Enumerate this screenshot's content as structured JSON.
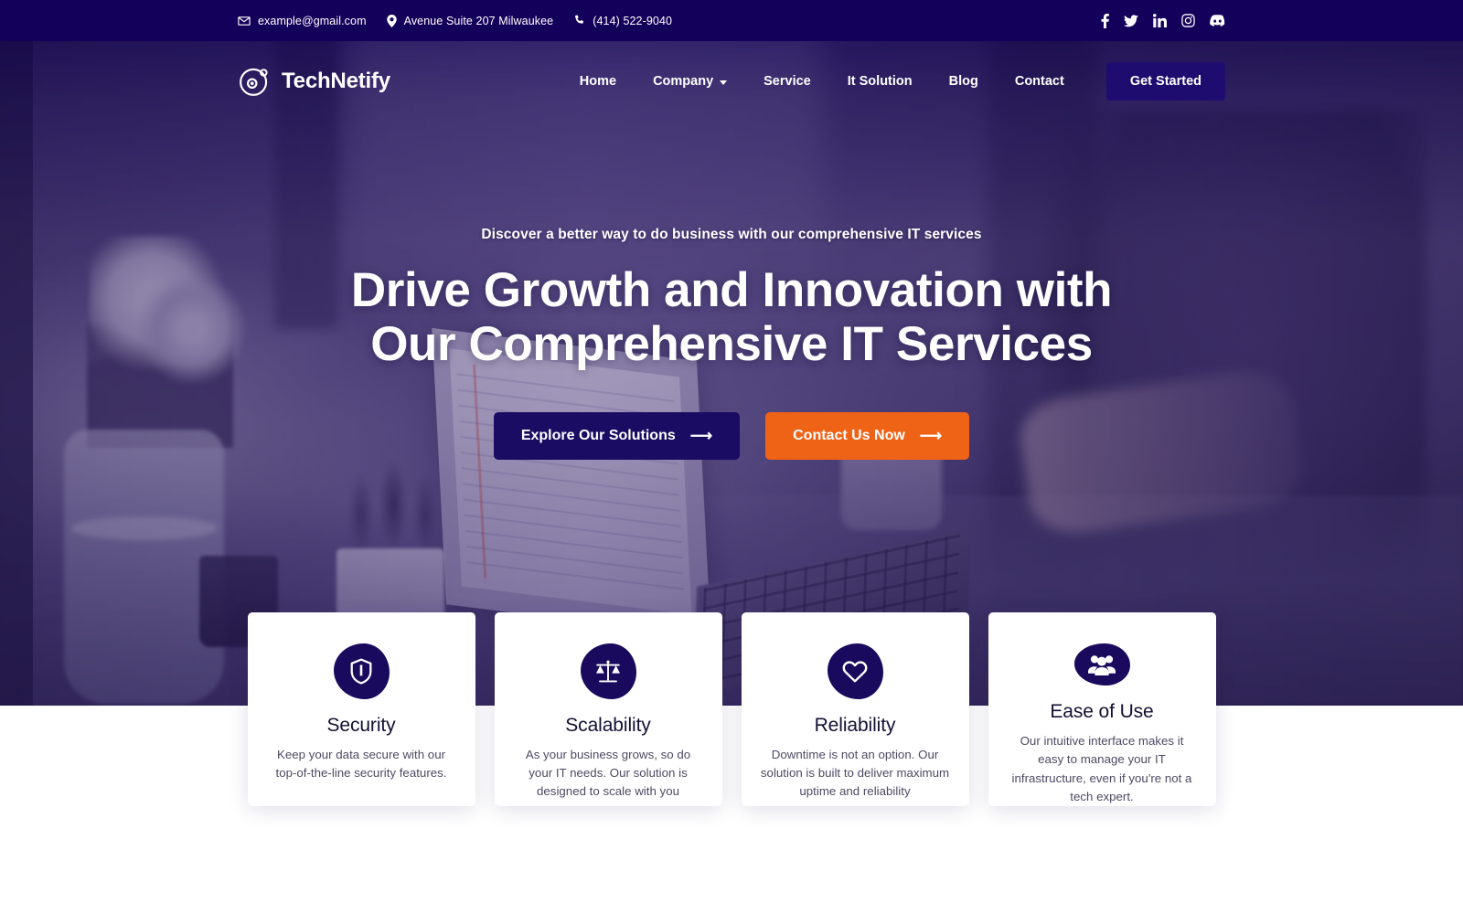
{
  "topbar": {
    "contacts": [
      {
        "icon": "envelope-icon",
        "text": "example@gmail.com"
      },
      {
        "icon": "location-pin-icon",
        "text": "Avenue Suite 207 Milwaukee"
      },
      {
        "icon": "phone-icon",
        "text": "(414) 522-9040"
      }
    ],
    "socials": [
      {
        "icon": "facebook-icon",
        "label": "Facebook"
      },
      {
        "icon": "twitter-icon",
        "label": "Twitter"
      },
      {
        "icon": "linkedin-icon",
        "label": "LinkedIn"
      },
      {
        "icon": "instagram-icon",
        "label": "Instagram"
      },
      {
        "icon": "discord-icon",
        "label": "Discord"
      }
    ],
    "background_color": "#13005a"
  },
  "navbar": {
    "brand": {
      "name": "TechNetify",
      "logo_icon": "orbit-circle-icon"
    },
    "menu": [
      {
        "label": "Home",
        "has_dropdown": false
      },
      {
        "label": "Company",
        "has_dropdown": true
      },
      {
        "label": "Service",
        "has_dropdown": false
      },
      {
        "label": "It Solution",
        "has_dropdown": false
      },
      {
        "label": "Blog",
        "has_dropdown": false
      },
      {
        "label": "Contact",
        "has_dropdown": false
      }
    ],
    "cta": {
      "label": "Get Started",
      "color": "#1e0d6e"
    }
  },
  "hero": {
    "eyebrow": "Discover a better way to do business with our comprehensive IT services",
    "title_line1": "Drive Growth and Innovation with",
    "title_line2": "Our Comprehensive IT Services",
    "buttons": [
      {
        "label": "Explore Our Solutions",
        "icon": "arrow-right-icon",
        "color": "#1a0b63"
      },
      {
        "label": "Contact Us Now",
        "icon": "arrow-right-icon",
        "color": "#ef6317"
      }
    ]
  },
  "features": {
    "icon_bg": "#190a5e",
    "cards": [
      {
        "icon": "shield-icon",
        "title": "Security",
        "desc": "Keep your data secure with our top-of-the-line security features."
      },
      {
        "icon": "balance-scale-icon",
        "title": "Scalability",
        "desc": "As your business grows, so do your IT needs. Our solution is designed to scale with you"
      },
      {
        "icon": "heart-icon",
        "title": "Reliability",
        "desc": "Downtime is not an option. Our solution is built to deliver maximum uptime and reliability"
      },
      {
        "icon": "users-group-icon",
        "title": "Ease of Use",
        "desc": "Our intuitive interface makes it easy to manage your IT infrastructure, even if you're not a tech expert."
      }
    ]
  }
}
